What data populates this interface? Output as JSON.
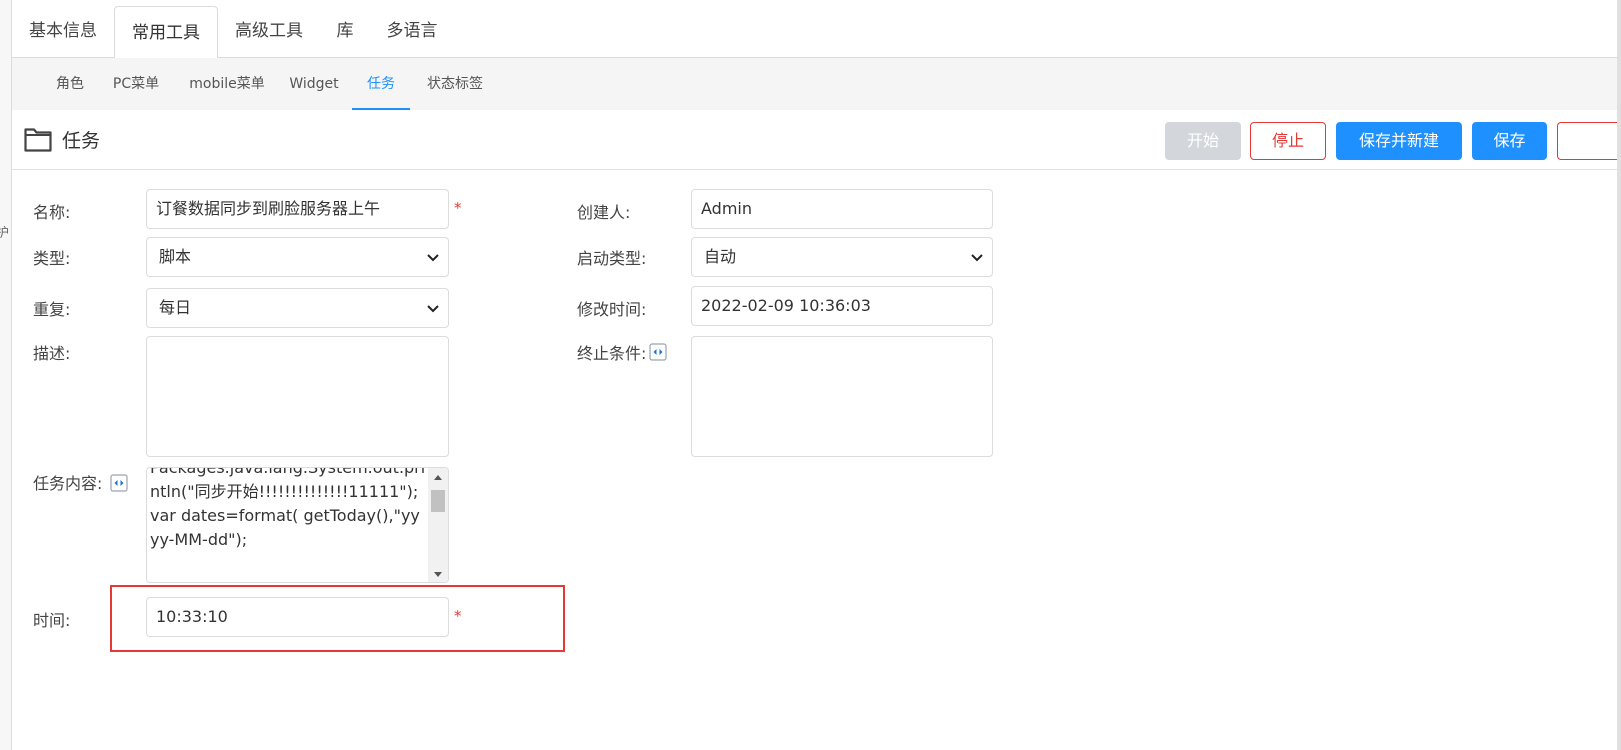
{
  "top_tabs": [
    "基本信息",
    "常用工具",
    "高级工具",
    "库",
    "多语言"
  ],
  "sub_tabs": [
    "角色",
    "PC菜单",
    "mobile菜单",
    "Widget",
    "任务",
    "状态标签"
  ],
  "left_rail_text": "护",
  "page": {
    "title": "任务",
    "icon": "folder-icon"
  },
  "toolbar": {
    "start_label": "开始",
    "stop_label": "停止",
    "save_new_label": "保存并新建",
    "save_label": "保存"
  },
  "form": {
    "name_label": "名称:",
    "name_value": "订餐数据同步到刷脸服务器上午",
    "type_label": "类型:",
    "type_value": "脚本",
    "repeat_label": "重复:",
    "repeat_value": "每日",
    "desc_label": "描述:",
    "desc_value": "",
    "content_label": "任务内容:",
    "content_value": "Packages.java.lang.System.out.println(\"同步开始!!!!!!!!!!!!!!11111\");\nvar dates=format( getToday(),\"yyyy-MM-dd\");",
    "time_label": "时间:",
    "time_value": "10:33:10",
    "creator_label": "创建人:",
    "creator_value": "Admin",
    "start_type_label": "启动类型:",
    "start_type_value": "自动",
    "modified_label": "修改时间:",
    "modified_value": "2022-02-09 10:36:03",
    "end_condition_label": "终止条件:",
    "end_condition_value": "",
    "required_mark": "*"
  },
  "colors": {
    "primary": "#1e90ff",
    "danger": "#e53935",
    "disabled": "#d3d6db"
  }
}
